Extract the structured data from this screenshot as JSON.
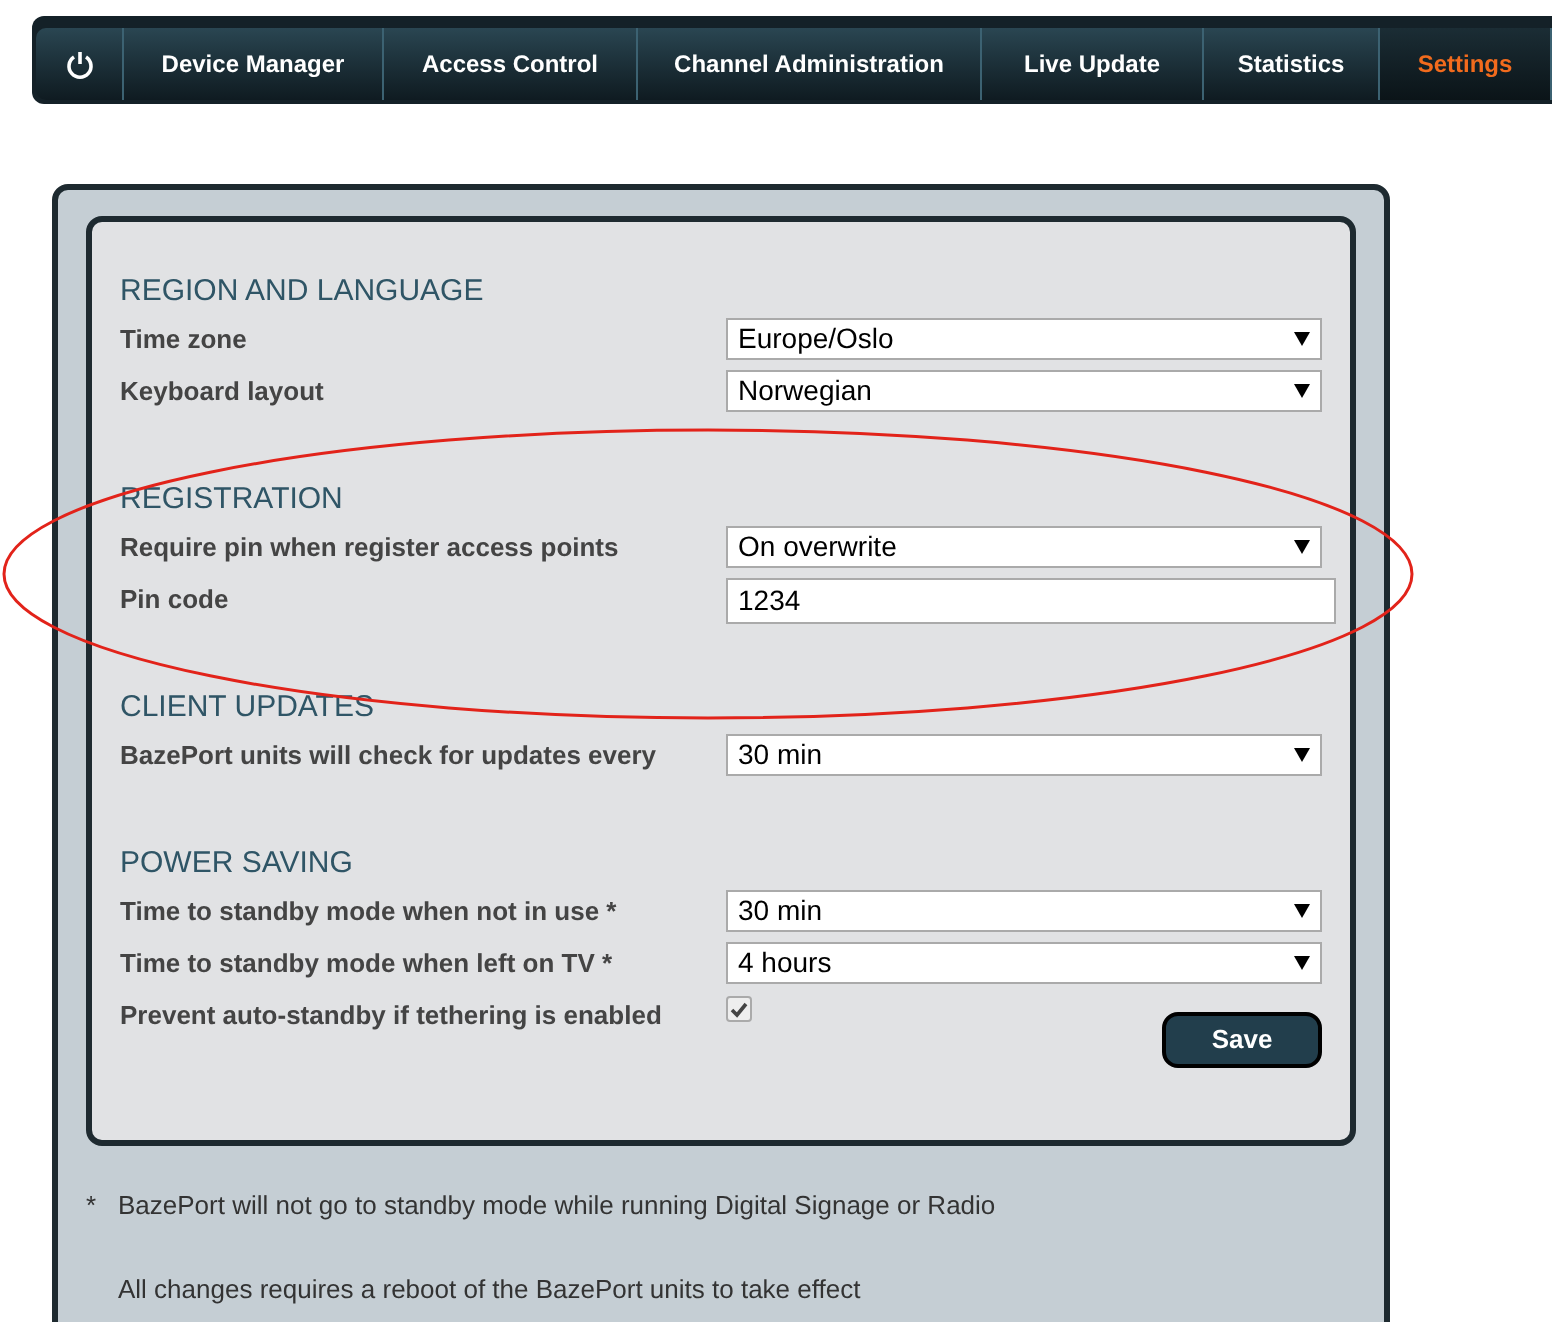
{
  "nav": {
    "tabs": [
      {
        "label": "Device Manager",
        "selected": false
      },
      {
        "label": "Access Control",
        "selected": false
      },
      {
        "label": "Channel Administration",
        "selected": false
      },
      {
        "label": "Live Update",
        "selected": false
      },
      {
        "label": "Statistics",
        "selected": false
      },
      {
        "label": "Settings",
        "selected": true
      }
    ]
  },
  "sections": [
    {
      "title": "REGION AND LANGUAGE",
      "rows": [
        {
          "kind": "select",
          "label": "Time zone",
          "value": "Europe/Oslo"
        },
        {
          "kind": "select",
          "label": "Keyboard layout",
          "value": "Norwegian"
        }
      ]
    },
    {
      "title": "REGISTRATION",
      "rows": [
        {
          "kind": "select",
          "label": "Require pin when register access points",
          "value": "On overwrite"
        },
        {
          "kind": "text",
          "label": "Pin code",
          "value": "1234"
        }
      ]
    },
    {
      "title": "CLIENT UPDATES",
      "rows": [
        {
          "kind": "select",
          "label": "BazePort units will check for updates every",
          "value": "30 min"
        }
      ]
    },
    {
      "title": "POWER SAVING",
      "rows": [
        {
          "kind": "select",
          "label": "Time to standby mode when not in use *",
          "value": "30 min"
        },
        {
          "kind": "select",
          "label": "Time to standby mode when left on TV *",
          "value": "4 hours"
        },
        {
          "kind": "checkbox",
          "label": "Prevent auto-standby if tethering is enabled",
          "checked": true
        }
      ]
    }
  ],
  "save_button": "Save",
  "notes": [
    {
      "marker": "*",
      "text": "BazePort will not go to standby mode while running Digital Signage or Radio"
    },
    {
      "text": "All changes requires a reboot of the BazePort units to take effect"
    }
  ]
}
